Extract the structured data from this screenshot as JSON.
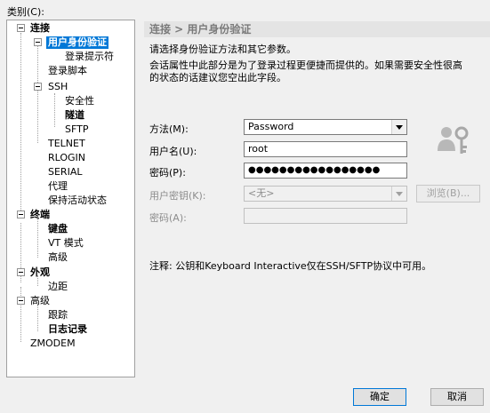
{
  "category_label": "类别(C):",
  "tree": [
    {
      "label": "连接",
      "bold": true
    },
    {
      "label": "用户身份验证",
      "bold": true,
      "selected": true
    },
    {
      "label": "登录提示符"
    },
    {
      "label": "登录脚本"
    },
    {
      "label": "SSH"
    },
    {
      "label": "安全性"
    },
    {
      "label": "隧道",
      "bold": true
    },
    {
      "label": "SFTP"
    },
    {
      "label": "TELNET"
    },
    {
      "label": "RLOGIN"
    },
    {
      "label": "SERIAL"
    },
    {
      "label": "代理"
    },
    {
      "label": "保持活动状态"
    },
    {
      "label": "终端",
      "bold": true
    },
    {
      "label": "键盘",
      "bold": true
    },
    {
      "label": "VT 模式"
    },
    {
      "label": "高级"
    },
    {
      "label": "外观",
      "bold": true
    },
    {
      "label": "边距"
    },
    {
      "label": "高级"
    },
    {
      "label": "跟踪"
    },
    {
      "label": "日志记录",
      "bold": true
    },
    {
      "label": "ZMODEM"
    }
  ],
  "breadcrumb": "连接 > 用户身份验证",
  "description": {
    "line1": "请选择身份验证方法和其它参数。",
    "line2": "会话属性中此部分是为了登录过程更便捷而提供的。如果需要安全性很高",
    "line3": "的状态的话建议您空出此字段。"
  },
  "form": {
    "method_label": "方法(M):",
    "method_value": "Password",
    "username_label": "用户名(U):",
    "username_value": "root",
    "password_label": "密码(P):",
    "password_value": "●●●●●●●●●●●●●●●●●",
    "user_key_label": "用户密钥(K):",
    "user_key_value": "<无>",
    "browse_label": "浏览(B)...",
    "passphrase_label": "密码(A):",
    "passphrase_value": ""
  },
  "note": "注释: 公钥和Keyboard Interactive仅在SSH/SFTP协议中可用。",
  "buttons": {
    "ok": "确定",
    "cancel": "取消"
  },
  "icons": {
    "key": "key-user-icon"
  },
  "colors": {
    "selection": "#0078d7",
    "header_bg": "#e4e4e4"
  }
}
